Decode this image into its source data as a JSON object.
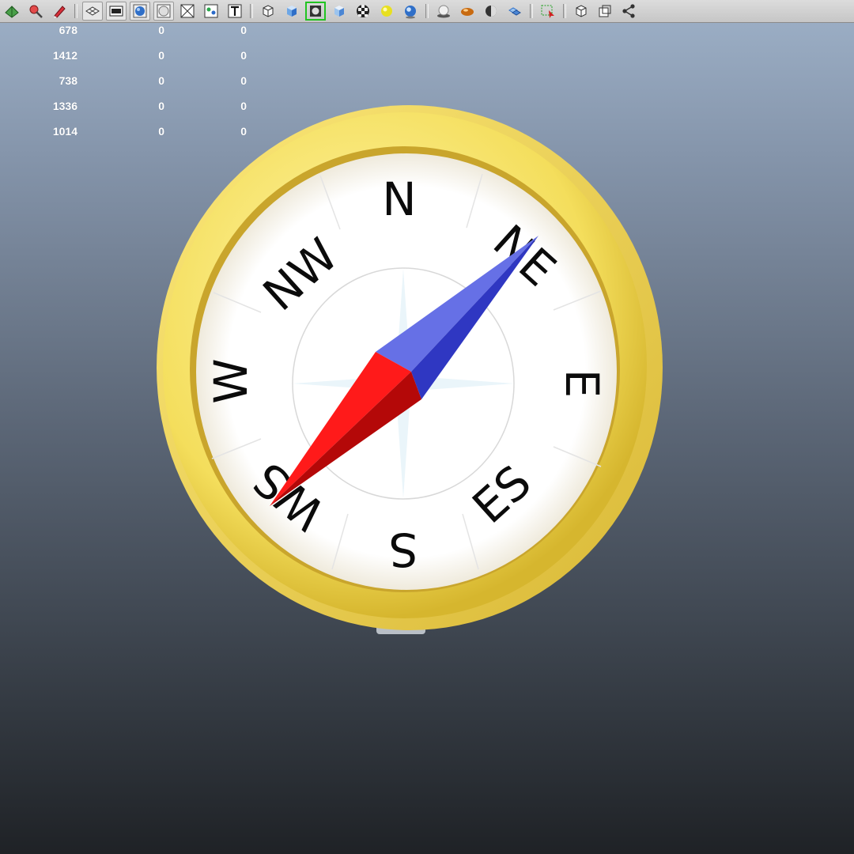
{
  "toolbar": {
    "buttons": [
      {
        "icon": "render-settings-icon"
      },
      {
        "icon": "paint-selection-icon"
      },
      {
        "icon": "sculpt-tool-icon"
      },
      {
        "icon": "separator"
      },
      {
        "icon": "grid-icon",
        "pressed": true
      },
      {
        "icon": "film-gate-icon",
        "pressed": true
      },
      {
        "icon": "smooth-shade-icon",
        "pressed": true
      },
      {
        "icon": "wireframe-on-shaded-icon",
        "pressed": true
      },
      {
        "icon": "xray-icon"
      },
      {
        "icon": "uv-texture-icon"
      },
      {
        "icon": "text-tool-icon"
      },
      {
        "icon": "separator"
      },
      {
        "icon": "wireframe-cube-icon"
      },
      {
        "icon": "shaded-cube-icon"
      },
      {
        "icon": "isolate-select-icon",
        "active": true
      },
      {
        "icon": "textured-cube-icon"
      },
      {
        "icon": "checker-ball-icon"
      },
      {
        "icon": "default-light-icon"
      },
      {
        "icon": "all-lights-icon"
      },
      {
        "icon": "separator"
      },
      {
        "icon": "shadows-icon"
      },
      {
        "icon": "material-ball-icon"
      },
      {
        "icon": "ambient-occlusion-icon"
      },
      {
        "icon": "motion-blur-icon"
      },
      {
        "icon": "separator"
      },
      {
        "icon": "select-camera-icon"
      },
      {
        "icon": "separator"
      },
      {
        "icon": "frame-all-icon"
      },
      {
        "icon": "two-panel-icon"
      },
      {
        "icon": "node-graph-icon"
      }
    ]
  },
  "hud": {
    "rows": [
      {
        "c1": "678",
        "c2": "0",
        "c3": "0"
      },
      {
        "c1": "1412",
        "c2": "0",
        "c3": "0"
      },
      {
        "c1": "738",
        "c2": "0",
        "c3": "0"
      },
      {
        "c1": "1336",
        "c2": "0",
        "c3": "0"
      },
      {
        "c1": "1014",
        "c2": "0",
        "c3": "0"
      }
    ]
  },
  "compass": {
    "labels": {
      "n": "N",
      "ne": "NE",
      "e": "E",
      "se": "ES",
      "s": "S",
      "sw": "WS",
      "w": "W",
      "nw": "NW"
    },
    "colors": {
      "bezel": "#f2dc5a",
      "face": "#ffffff",
      "needle_north": "#4a55d8",
      "needle_south": "#e01010",
      "background_top": "#9eb1c8",
      "background_bottom": "#1f2226"
    }
  }
}
